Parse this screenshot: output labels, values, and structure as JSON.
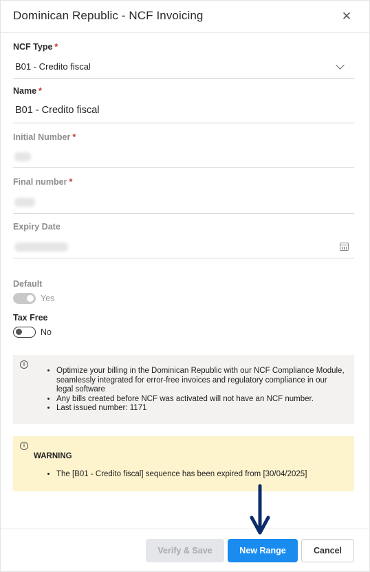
{
  "dialog": {
    "title": "Dominican Republic - NCF Invoicing",
    "close_icon": "close-icon"
  },
  "form": {
    "ncf_type": {
      "label": "NCF Type",
      "required_mark": "*",
      "value": "B01 - Credito fiscal"
    },
    "name": {
      "label": "Name",
      "required_mark": "*",
      "value": "B01 - Credito fiscal"
    },
    "initial_number": {
      "label": "Initial Number",
      "required_mark": "*"
    },
    "final_number": {
      "label": "Final number",
      "required_mark": "*"
    },
    "expiry_date": {
      "label": "Expiry Date",
      "icon": "calendar-icon"
    },
    "default": {
      "label": "Default",
      "toggle_text": "Yes",
      "enabled": true
    },
    "tax_free": {
      "label": "Tax Free",
      "toggle_text": "No",
      "enabled": false
    }
  },
  "info": {
    "icon": "info-icon",
    "items": [
      "Optimize your billing in the Dominican Republic with our NCF Compliance Module, seamlessly integrated for error-free invoices and regulatory compliance in our legal software",
      "Any bills created before NCF was activated will not have an NCF number.",
      "Last issued number: 1171"
    ]
  },
  "warning": {
    "icon": "info-icon",
    "title": "WARNING",
    "items": [
      "The [B01 - Credito fiscal] sequence has been expired from [30/04/2025]"
    ]
  },
  "footer": {
    "verify_label": "Verify & Save",
    "new_range_label": "New Range",
    "cancel_label": "Cancel"
  },
  "colors": {
    "primary": "#1a8cf0",
    "warning_bg": "#fdf3cd",
    "info_bg": "#f3f2f1",
    "annotation_arrow": "#0b2d6b"
  }
}
